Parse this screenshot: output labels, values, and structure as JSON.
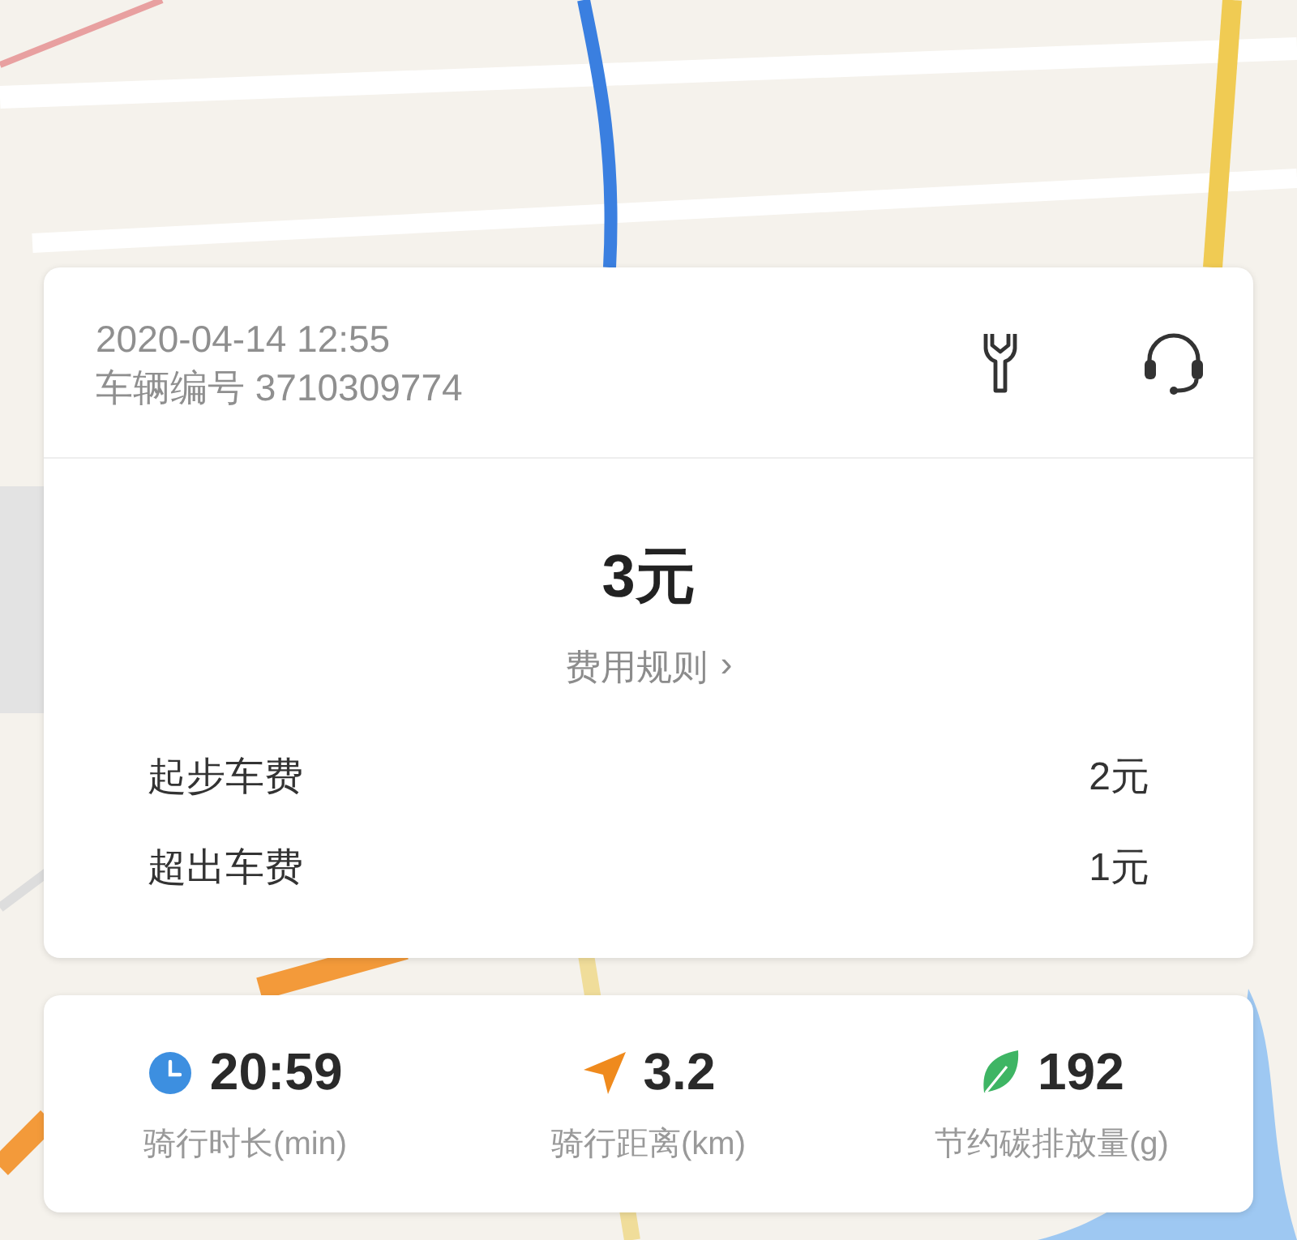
{
  "trip": {
    "datetime": "2020-04-14 12:55",
    "vehicle": "车辆编号 3710309774"
  },
  "fare": {
    "total": "3元",
    "rules_link": "费用规则",
    "rules_chevron": "›",
    "items": [
      {
        "label": "起步车费",
        "amount": "2元"
      },
      {
        "label": "超出车费",
        "amount": "1元"
      }
    ]
  },
  "stats": [
    {
      "kind": "time",
      "value": "20:59",
      "label": "骑行时长(min)"
    },
    {
      "kind": "distance",
      "value": "3.2",
      "label": "骑行距离(km)"
    },
    {
      "kind": "carbon",
      "value": "192",
      "label": "节约碳排放量(g)"
    }
  ]
}
